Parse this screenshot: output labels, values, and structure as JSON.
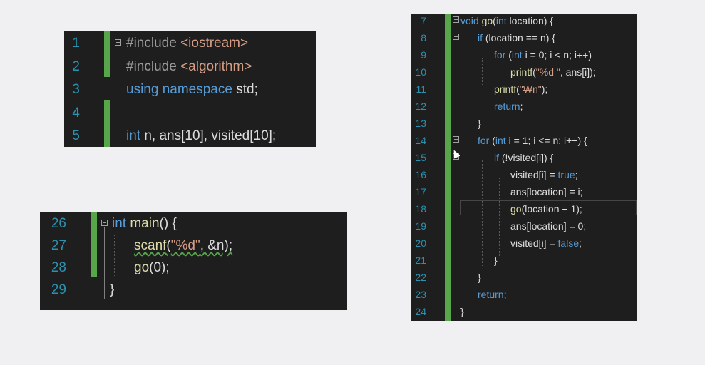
{
  "panel_top": {
    "lines": [
      {
        "num": "1",
        "parts": [
          [
            "pre",
            "#include "
          ],
          [
            "inc",
            "<iostream>"
          ]
        ]
      },
      {
        "num": "2",
        "parts": [
          [
            "pre",
            "#include "
          ],
          [
            "inc",
            "<algorithm>"
          ]
        ]
      },
      {
        "num": "3",
        "parts": [
          [
            "kw",
            "using "
          ],
          [
            "kw",
            "namespace "
          ],
          [
            "var",
            "std;"
          ]
        ]
      },
      {
        "num": "4",
        "parts": []
      },
      {
        "num": "5",
        "parts": [
          [
            "kw",
            "int "
          ],
          [
            "var",
            "n, ans[10], visited[10];"
          ]
        ]
      }
    ]
  },
  "panel_main": {
    "lines": [
      {
        "num": "26",
        "parts": [
          [
            "kw",
            "int "
          ],
          [
            "fn",
            "main"
          ],
          [
            "var",
            "() {"
          ]
        ]
      },
      {
        "num": "27",
        "parts": [
          [
            "fn",
            "scanf"
          ],
          [
            "var",
            "("
          ],
          [
            "str",
            "\"%d\""
          ],
          [
            "var",
            ", &n);"
          ]
        ]
      },
      {
        "num": "28",
        "parts": [
          [
            "fn",
            "go"
          ],
          [
            "var",
            "(0);"
          ]
        ]
      },
      {
        "num": "29",
        "parts": [
          [
            "var",
            "}"
          ]
        ]
      }
    ]
  },
  "panel_go": {
    "lines": [
      {
        "num": "7",
        "parts": [
          [
            "kw",
            "void "
          ],
          [
            "fn",
            "go"
          ],
          [
            "var",
            "("
          ],
          [
            "kw",
            "int "
          ],
          [
            "var",
            "location) {"
          ]
        ]
      },
      {
        "num": "8",
        "parts": [
          [
            "kw",
            "if "
          ],
          [
            "var",
            "(location == n) {"
          ]
        ]
      },
      {
        "num": "9",
        "parts": [
          [
            "kw",
            "for "
          ],
          [
            "var",
            "("
          ],
          [
            "kw",
            "int "
          ],
          [
            "var",
            "i = 0; i < n; i++)"
          ]
        ]
      },
      {
        "num": "10",
        "parts": [
          [
            "fn",
            "printf"
          ],
          [
            "var",
            "("
          ],
          [
            "str",
            "\"%d \""
          ],
          [
            "var",
            ", ans[i]);"
          ]
        ]
      },
      {
        "num": "11",
        "parts": [
          [
            "fn",
            "printf"
          ],
          [
            "var",
            "("
          ],
          [
            "str",
            "\"₩n\""
          ],
          [
            "var",
            ");"
          ]
        ]
      },
      {
        "num": "12",
        "parts": [
          [
            "kw",
            "return"
          ],
          [
            "var",
            ";"
          ]
        ]
      },
      {
        "num": "13",
        "parts": [
          [
            "var",
            "}"
          ]
        ]
      },
      {
        "num": "14",
        "parts": [
          [
            "kw",
            "for "
          ],
          [
            "var",
            "("
          ],
          [
            "kw",
            "int "
          ],
          [
            "var",
            "i = 1; i <= n; i++) {"
          ]
        ]
      },
      {
        "num": "15",
        "parts": [
          [
            "kw",
            "if "
          ],
          [
            "var",
            "(!visited[i]) {"
          ]
        ]
      },
      {
        "num": "16",
        "parts": [
          [
            "var",
            "visited[i] = "
          ],
          [
            "kw",
            "true"
          ],
          [
            "var",
            ";"
          ]
        ]
      },
      {
        "num": "17",
        "parts": [
          [
            "var",
            "ans[location] = i;"
          ]
        ]
      },
      {
        "num": "18",
        "parts": [
          [
            "fn",
            "go"
          ],
          [
            "var",
            "(location + 1);"
          ]
        ]
      },
      {
        "num": "19",
        "parts": [
          [
            "var",
            "ans[location] = 0;"
          ]
        ]
      },
      {
        "num": "20",
        "parts": [
          [
            "var",
            "visited[i] = "
          ],
          [
            "kw",
            "false"
          ],
          [
            "var",
            ";"
          ]
        ]
      },
      {
        "num": "21",
        "parts": [
          [
            "var",
            "}"
          ]
        ]
      },
      {
        "num": "22",
        "parts": [
          [
            "var",
            "}"
          ]
        ]
      },
      {
        "num": "23",
        "parts": [
          [
            "kw",
            "return"
          ],
          [
            "var",
            ";"
          ]
        ]
      },
      {
        "num": "24",
        "parts": [
          [
            "var",
            "}"
          ]
        ]
      }
    ]
  },
  "colors": {
    "editor_bg": "#1e1e1e",
    "line_number": "#2b91af",
    "keyword": "#569cd6",
    "function": "#dcdcaa",
    "string": "#d69d85",
    "change_bar": "#57a64a"
  }
}
